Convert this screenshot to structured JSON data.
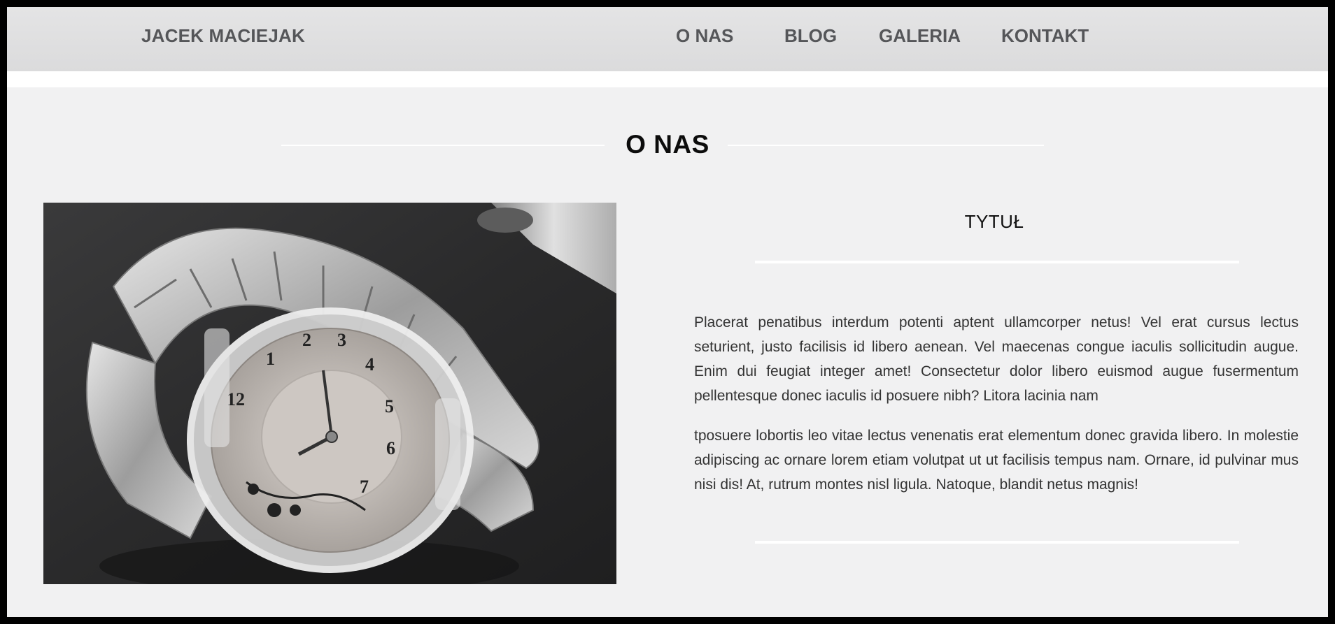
{
  "header": {
    "brand": "JACEK MACIEJAK",
    "nav": [
      {
        "label": "O NAS"
      },
      {
        "label": "BLOG"
      },
      {
        "label": "GALERIA"
      },
      {
        "label": "KONTAKT"
      }
    ]
  },
  "section": {
    "title": "O NAS"
  },
  "content": {
    "subtitle": "TYTUŁ",
    "paragraphs": [
      "Placerat penatibus interdum potenti aptent ullamcorper netus! Vel erat cursus lectus seturient, justo facilisis id libero aenean. Vel maecenas congue iaculis sollicitudin augue. Enim dui feugiat integer amet! Consectetur dolor libero euismod augue fusermentum pellentesque donec iaculis id posuere nibh? Litora lacinia nam",
      "tposuere lobortis leo vitae lectus venenatis erat elementum donec gravida libero. In molestie adipiscing ac ornare lorem etiam volutpat ut ut facilisis tempus nam. Ornare, id pulvinar mus nisi dis! At, rutrum montes nisl ligula. Natoque, blandit netus magnis!"
    ]
  },
  "image": {
    "subject": "wristwatch-photo",
    "dial_numbers": [
      "12",
      "1",
      "2",
      "3",
      "4",
      "5",
      "6",
      "7"
    ]
  },
  "colors": {
    "navbar": "#dedee0",
    "nav_text": "#555659",
    "page_bg": "#f1f1f2",
    "frame": "#000000"
  }
}
